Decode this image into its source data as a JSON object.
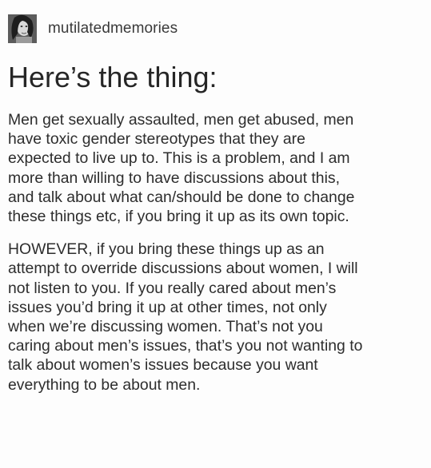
{
  "post": {
    "author": {
      "username": "mutilatedmemories",
      "avatar_icon": "avatar-photo-icon"
    },
    "title": "Here’s the thing:",
    "paragraphs": [
      {
        "lines": [
          "Men get sexually assaulted, men get abused, men",
          "have toxic gender stereotypes that they are",
          "expected to live up to. This is a problem, and I am",
          "more than willing to have discussions about this,",
          "and talk about what can/should be done to change",
          "these things etc, if you bring it up as its own topic."
        ]
      },
      {
        "lines": [
          "HOWEVER, if you bring these things up as an",
          "attempt to override discussions about women, I will",
          "not listen to you. If you really cared about men’s",
          "issues you’d bring it up at other times, not only",
          "when we’re discussing women. That’s not you",
          "caring about men’s issues, that’s you not wanting to",
          "talk about women’s issues because you want",
          "everything to be about men."
        ]
      }
    ]
  },
  "colors": {
    "background": "#fdfdfd",
    "text": "#2d2d2d",
    "username": "#3a3a3a"
  }
}
